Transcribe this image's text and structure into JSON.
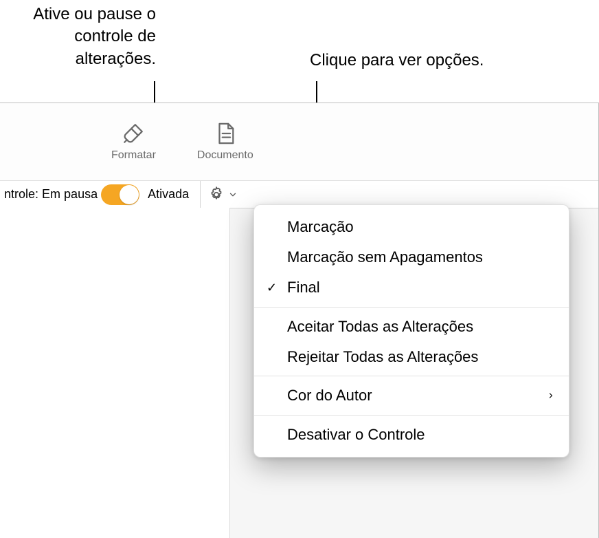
{
  "callouts": {
    "left": "Ative ou pause o controle de alterações.",
    "right": "Clique para ver opções."
  },
  "toolbar": {
    "formatar_label": "Formatar",
    "documento_label": "Documento"
  },
  "track_bar": {
    "status_prefix": "ntrole:",
    "status_value": "Em pausa",
    "activated": "Ativada"
  },
  "menu": {
    "items": {
      "marcacao": "Marcação",
      "marcacao_sem_apagamentos": "Marcação sem Apagamentos",
      "final": "Final",
      "aceitar": "Aceitar Todas as Alterações",
      "rejeitar": "Rejeitar Todas as Alterações",
      "cor_do_autor": "Cor do Autor",
      "desativar": "Desativar o Controle"
    }
  },
  "chart_data": null
}
